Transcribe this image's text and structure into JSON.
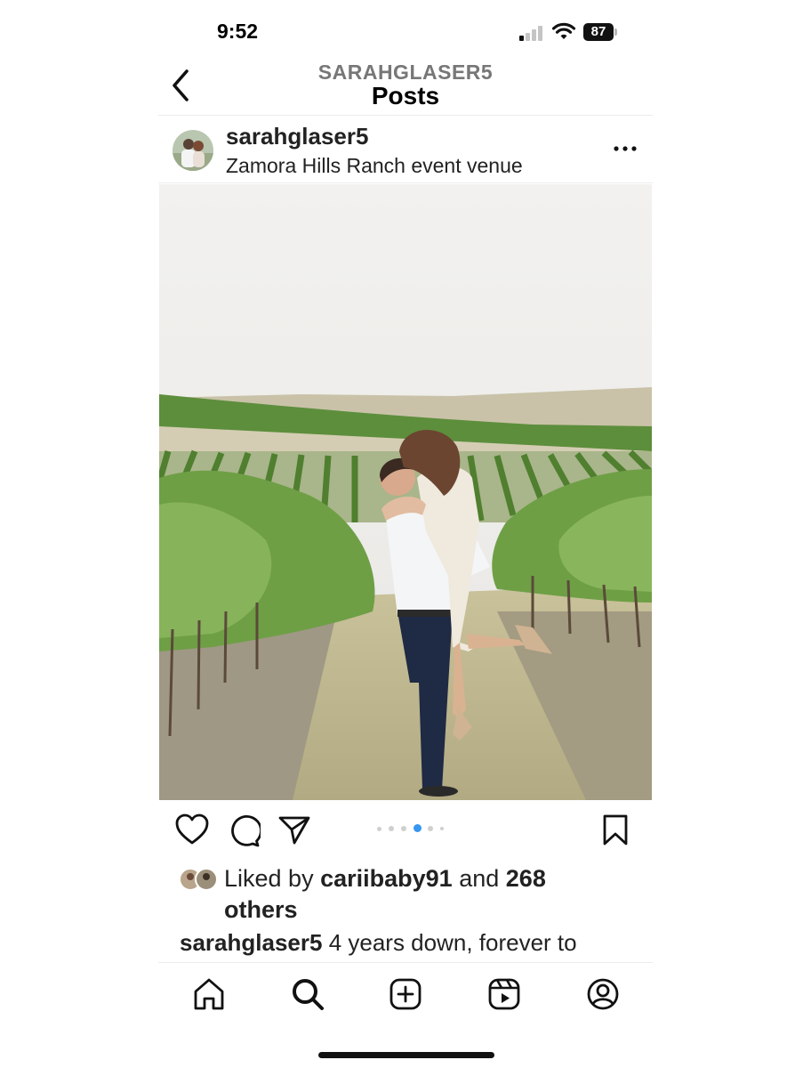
{
  "status_bar": {
    "time": "9:52",
    "battery": "87",
    "signal_bars_active": 1,
    "icons": [
      "signal-icon",
      "wifi-icon",
      "battery-icon"
    ]
  },
  "header": {
    "username": "SARAHGLASER5",
    "title": "Posts",
    "back_icon": "chevron-left-icon"
  },
  "post": {
    "username": "sarahglaser5",
    "location": "Zamora Hills Ranch event venue",
    "more_icon": "more-horizontal-icon",
    "carousel": {
      "total": 6,
      "active_index": 3
    },
    "actions": [
      "heart-icon",
      "comment-icon",
      "share-icon",
      "bookmark-icon"
    ],
    "likes": {
      "prefix": "Liked by",
      "user": "cariibaby91",
      "conjunction": "and",
      "count": "268",
      "suffix": "others"
    },
    "caption": {
      "username": "sarahglaser5",
      "text": "4 years down, forever to"
    }
  },
  "tab_bar": {
    "items": [
      "home-icon",
      "search-icon",
      "create-post-icon",
      "reels-icon",
      "profile-icon"
    ],
    "active": "search-icon"
  },
  "colors": {
    "text": "#111111",
    "muted": "#777777",
    "carousel_active": "#3897f0",
    "divider": "#ececec"
  }
}
